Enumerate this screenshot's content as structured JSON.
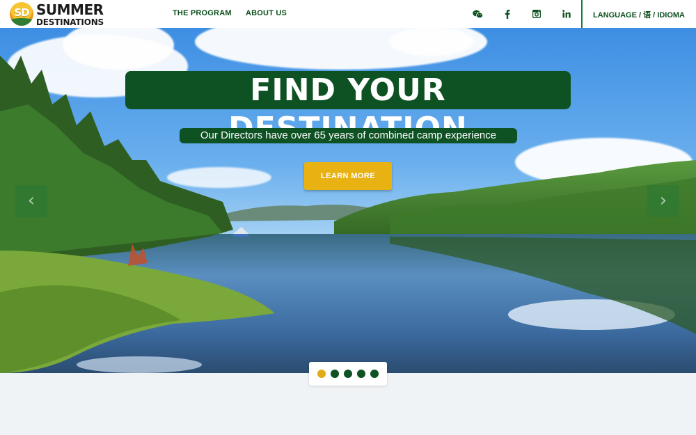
{
  "brand": {
    "badge": "SD",
    "line1": "SUMMER",
    "line2": "DESTINATIONS"
  },
  "nav": [
    {
      "label": "THE PROGRAM"
    },
    {
      "label": "ABOUT US"
    }
  ],
  "social": [
    {
      "icon": "wechat-icon"
    },
    {
      "icon": "facebook-icon"
    },
    {
      "icon": "instagram-icon"
    },
    {
      "icon": "linkedin-icon"
    }
  ],
  "language": "LANGUAGE / 语 / IDIOMA",
  "hero": {
    "title": "FIND YOUR DESTINATION",
    "subtitle": "Our Directors have over 65 years of combined camp experience",
    "cta": "LEARN MORE"
  },
  "carousel": {
    "slides": 5,
    "active": 1,
    "prev": "‹",
    "next": "›"
  },
  "colors": {
    "brand_green": "#0e5224",
    "accent_gold": "#e8b213",
    "divider_green": "#1d7a2e"
  }
}
